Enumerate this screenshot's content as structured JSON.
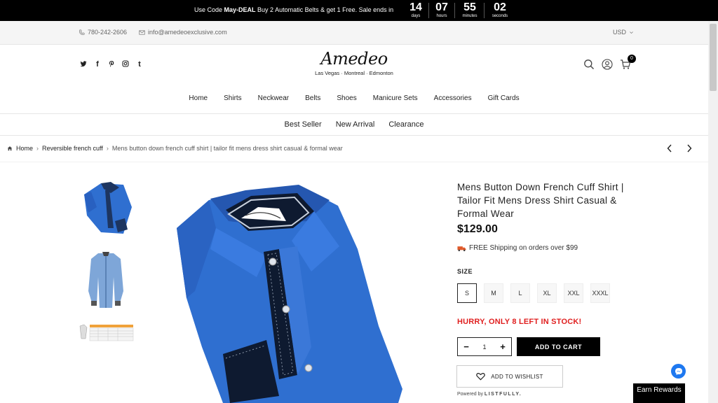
{
  "promo": {
    "prefix": "Use Code ",
    "code": "May-DEAL",
    "suffix": " Buy 2 Automatic Belts & get 1 Free. Sale ends in",
    "countdown": [
      {
        "value": "14",
        "unit": "days"
      },
      {
        "value": "07",
        "unit": "hours"
      },
      {
        "value": "55",
        "unit": "minutes"
      },
      {
        "value": "02",
        "unit": "seconds"
      }
    ]
  },
  "topbar": {
    "phone": "780-242-2606",
    "email": "info@amedeoexclusive.com",
    "currency": "USD"
  },
  "header": {
    "social_icons": [
      "twitter-icon",
      "facebook-icon",
      "pinterest-icon",
      "instagram-icon",
      "tumblr-icon"
    ],
    "logo_text": "Amedeo",
    "locations": "Las Vegas · Montreal · Edmonton",
    "cart_count": "0"
  },
  "nav": {
    "main": [
      "Home",
      "Shirts",
      "Neckwear",
      "Belts",
      "Shoes",
      "Manicure Sets",
      "Accessories",
      "Gift Cards"
    ],
    "secondary": [
      "Best Seller",
      "New Arrival",
      "Clearance"
    ]
  },
  "breadcrumb": {
    "home": "Home",
    "category": "Reversible french cuff",
    "current": "Mens button down french cuff shirt | tailor fit mens dress shirt casual & formal wear"
  },
  "product": {
    "title": "Mens Button Down French Cuff Shirt | Tailor Fit Mens Dress Shirt Casual & Formal Wear",
    "price": "$129.00",
    "shipping": "FREE Shipping on orders over $99",
    "size_label": "SIZE",
    "sizes": [
      "S",
      "M",
      "L",
      "XL",
      "XXL",
      "XXXL"
    ],
    "selected_size": "S",
    "stock_message": "HURRY, ONLY 8 LEFT IN STOCK!",
    "quantity": "1",
    "add_to_cart": "ADD TO CART",
    "add_to_wishlist": "ADD TO WISHLIST",
    "powered_by": "Powered by",
    "powered_brand": "LISTFULLY."
  },
  "widgets": {
    "rewards": "Earn Rewards"
  },
  "colors": {
    "shirt_blue": "#2f6fd0",
    "stock_red": "#e02020",
    "messenger_blue": "#1e78f0"
  }
}
